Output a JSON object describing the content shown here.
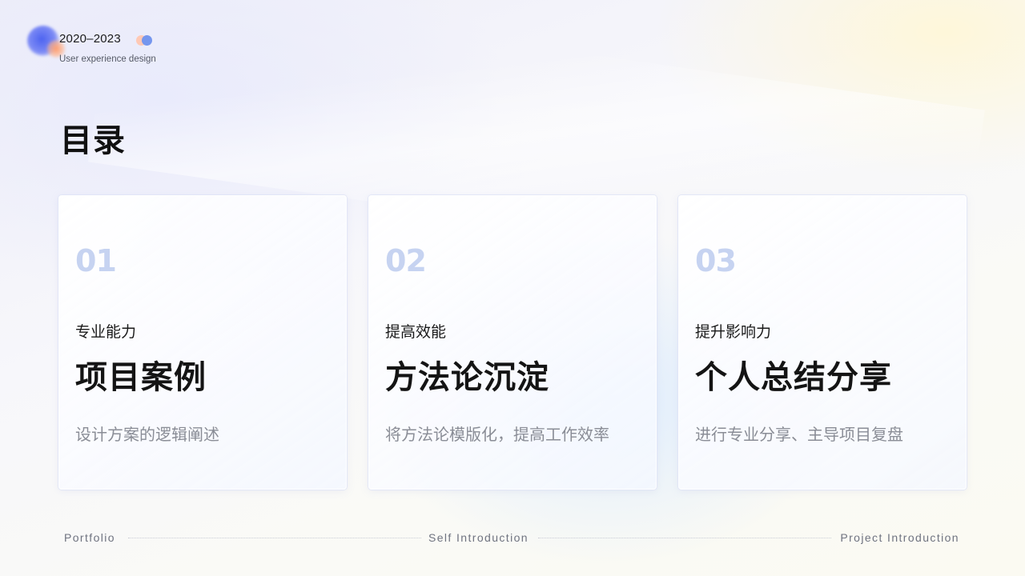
{
  "brand": {
    "years": "2020–2023",
    "subtitle": "User experience design"
  },
  "page": {
    "title": "目录"
  },
  "cards": [
    {
      "number": "01",
      "subtitle": "专业能力",
      "title": "项目案例",
      "description": "设计方案的逻辑阐述"
    },
    {
      "number": "02",
      "subtitle": "提高效能",
      "title": "方法论沉淀",
      "description": "将方法论模版化，提高工作效率"
    },
    {
      "number": "03",
      "subtitle": "提升影响力",
      "title": "个人总结分享",
      "description": "进行专业分享、主导项目复盘"
    }
  ],
  "footer": {
    "left": "Portfolio",
    "center": "Self Introduction",
    "right": "Project Introduction"
  },
  "colors": {
    "accent_blue": "#7596ee",
    "accent_peach": "#ffc9b5",
    "number_tint": "#c6d3f1",
    "description_gray": "#8a8d96"
  }
}
